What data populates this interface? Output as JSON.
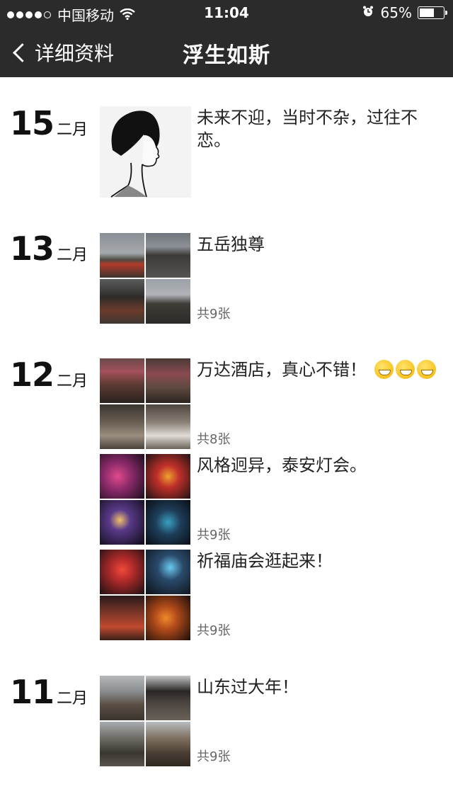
{
  "status_bar": {
    "carrier": "中国移动",
    "time": "11:04",
    "battery_percent": "65%",
    "battery_level": 0.65,
    "icons": [
      "signal-dots-icon",
      "wifi-icon",
      "alarm-icon",
      "battery-icon"
    ]
  },
  "nav": {
    "back_label": "详细资料",
    "title": "浮生如斯"
  },
  "days": [
    {
      "day": "15",
      "month": "二月",
      "posts": [
        {
          "kind": "avatar",
          "text": "未来不迎，当时不杂，过往不恋。"
        }
      ]
    },
    {
      "day": "13",
      "month": "二月",
      "posts": [
        {
          "kind": "album",
          "text": "五岳独尊",
          "count": "共9张"
        }
      ]
    },
    {
      "day": "12",
      "month": "二月",
      "posts": [
        {
          "kind": "album",
          "text": "万达酒店，真心不错！",
          "emoji_count": 3,
          "count": "共8张"
        },
        {
          "kind": "album",
          "text": "风格迥异，泰安灯会。",
          "count": "共9张"
        },
        {
          "kind": "album",
          "text": "祈福庙会逛起来！",
          "count": "共9张"
        }
      ]
    },
    {
      "day": "11",
      "month": "二月",
      "posts": [
        {
          "kind": "album",
          "text": "山东过大年！",
          "count": "共9张"
        }
      ]
    }
  ],
  "colors": {
    "bar_bg": "#2b2b2b",
    "text": "#222222",
    "count_text": "#666666"
  }
}
